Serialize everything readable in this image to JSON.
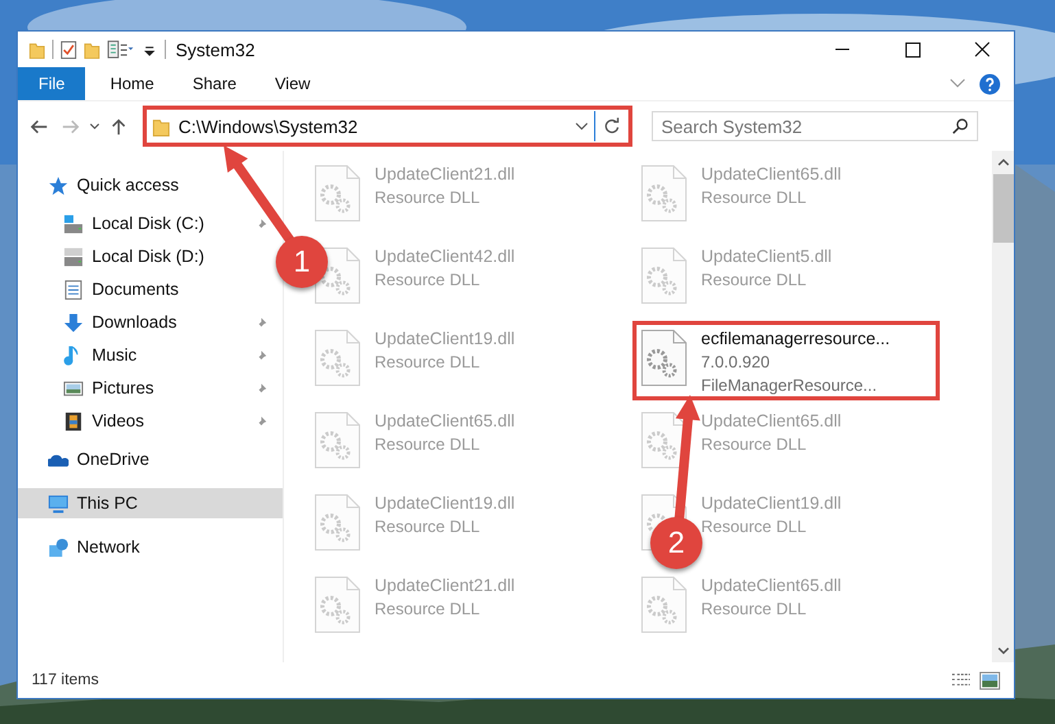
{
  "window": {
    "title": "System32"
  },
  "ribbon": {
    "tabs": [
      {
        "label": "File",
        "kind": "file"
      },
      {
        "label": "Home",
        "kind": "tab"
      },
      {
        "label": "Share",
        "kind": "tab"
      },
      {
        "label": "View",
        "kind": "tab"
      }
    ]
  },
  "address": {
    "path": "C:\\Windows\\System32",
    "highlighted": true
  },
  "search": {
    "placeholder": "Search System32"
  },
  "sidebar": {
    "items": [
      {
        "label": "Quick access",
        "kind": "star",
        "selected": false,
        "children": [
          {
            "label": "Local Disk (C:)",
            "kind": "system-drive",
            "selected": false,
            "pinned": true
          },
          {
            "label": "Local Disk (D:)",
            "kind": "drive",
            "selected": false,
            "pinned": false
          },
          {
            "label": "Documents",
            "kind": "documents",
            "selected": false,
            "pinned": false
          },
          {
            "label": "Downloads",
            "kind": "downloads",
            "selected": false,
            "pinned": true
          },
          {
            "label": "Music",
            "kind": "music",
            "selected": false,
            "pinned": true
          },
          {
            "label": "Pictures",
            "kind": "pictures",
            "selected": false,
            "pinned": true
          },
          {
            "label": "Videos",
            "kind": "videos",
            "selected": false,
            "pinned": true
          }
        ]
      },
      {
        "label": "OneDrive",
        "kind": "cloud",
        "selected": false
      },
      {
        "label": "This PC",
        "kind": "pc",
        "selected": true
      },
      {
        "label": "Network",
        "kind": "network",
        "selected": false
      }
    ]
  },
  "files": [
    {
      "kind": "faded",
      "name": "UpdateClient21.dll",
      "lines": [
        "Resource DLL"
      ],
      "highlighted": false
    },
    {
      "kind": "faded",
      "name": "UpdateClient65.dll",
      "lines": [
        "Resource DLL"
      ],
      "highlighted": false
    },
    {
      "kind": "faded",
      "name": "UpdateClient42.dll",
      "lines": [
        "Resource DLL"
      ],
      "highlighted": false
    },
    {
      "kind": "faded",
      "name": "UpdateClient5.dll",
      "lines": [
        "Resource DLL"
      ],
      "highlighted": false
    },
    {
      "kind": "faded",
      "name": "UpdateClient19.dll",
      "lines": [
        "Resource DLL"
      ],
      "highlighted": false
    },
    {
      "kind": "sharp",
      "name": "ecfilemanagerresource...",
      "lines": [
        "7.0.0.920",
        "FileManagerResource..."
      ],
      "highlighted": true
    },
    {
      "kind": "faded",
      "name": "UpdateClient65.dll",
      "lines": [
        "Resource DLL"
      ],
      "highlighted": false
    },
    {
      "kind": "faded",
      "name": "UpdateClient65.dll",
      "lines": [
        "Resource DLL"
      ],
      "highlighted": false
    },
    {
      "kind": "faded",
      "name": "UpdateClient19.dll",
      "lines": [
        "Resource DLL"
      ],
      "highlighted": false
    },
    {
      "kind": "faded",
      "name": "UpdateClient19.dll",
      "lines": [
        "Resource DLL"
      ],
      "highlighted": false
    },
    {
      "kind": "faded",
      "name": "UpdateClient21.dll",
      "lines": [
        "Resource DLL"
      ],
      "highlighted": false
    },
    {
      "kind": "faded",
      "name": "UpdateClient65.dll",
      "lines": [
        "Resource DLL"
      ],
      "highlighted": false
    }
  ],
  "status_bar": {
    "count": "117 items"
  },
  "annotations": [
    {
      "label": "1"
    },
    {
      "label": "2"
    }
  ]
}
